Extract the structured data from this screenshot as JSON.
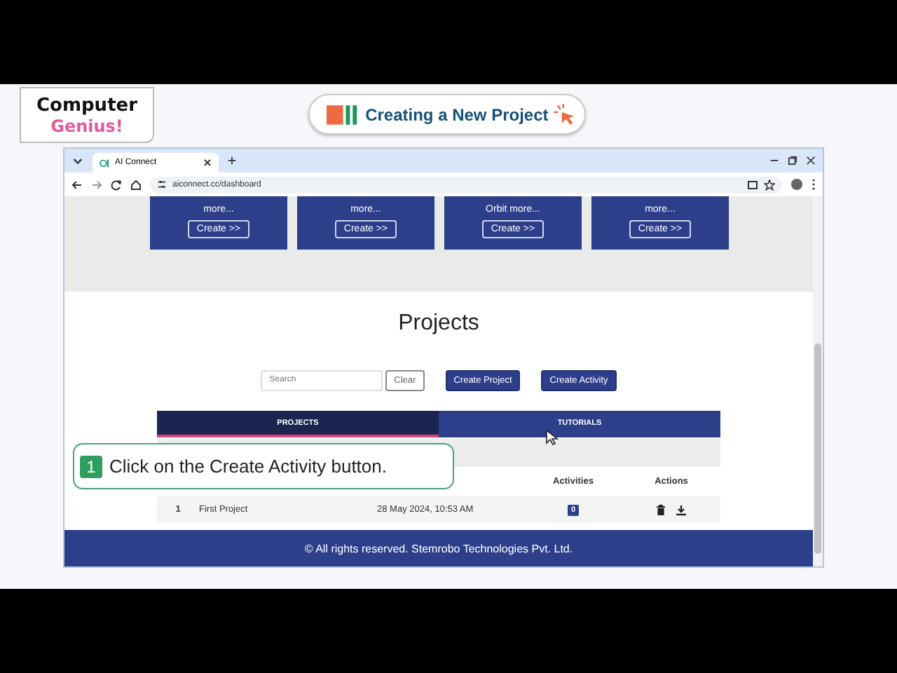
{
  "logo": {
    "line1": "Computer",
    "line2": "Genius!"
  },
  "lesson_title": "Creating a New Project",
  "browser": {
    "tab_title": "AI Connect",
    "url": "aiconnect.cc/dashboard"
  },
  "cards": [
    {
      "text": "more...",
      "button": "Create >>"
    },
    {
      "text": "more...",
      "button": "Create >>"
    },
    {
      "text": "Orbit more...",
      "button": "Create >>"
    },
    {
      "text": "more...",
      "button": "Create >>"
    }
  ],
  "page_title": "Projects",
  "search": {
    "placeholder": "Search"
  },
  "buttons": [
    {
      "label": "Clear",
      "kind": "outline"
    },
    {
      "label": "Create Project",
      "kind": "primary"
    },
    {
      "label": "Create Activity",
      "kind": "primary"
    }
  ],
  "tabs": [
    {
      "label": "PROJECTS",
      "selected": true
    },
    {
      "label": "TUTORIALS",
      "selected": false
    }
  ],
  "table": {
    "columns": [
      "Activities",
      "Actions"
    ],
    "rows": [
      {
        "index": "1",
        "name": "First Project",
        "date": "28 May 2024, 10:53 AM",
        "activities": "0"
      }
    ]
  },
  "footer": "© All rights reserved. Stemrobo Technologies Pvt. Ltd.",
  "callout": {
    "step": "1",
    "text": "Click on the Create Activity button."
  }
}
